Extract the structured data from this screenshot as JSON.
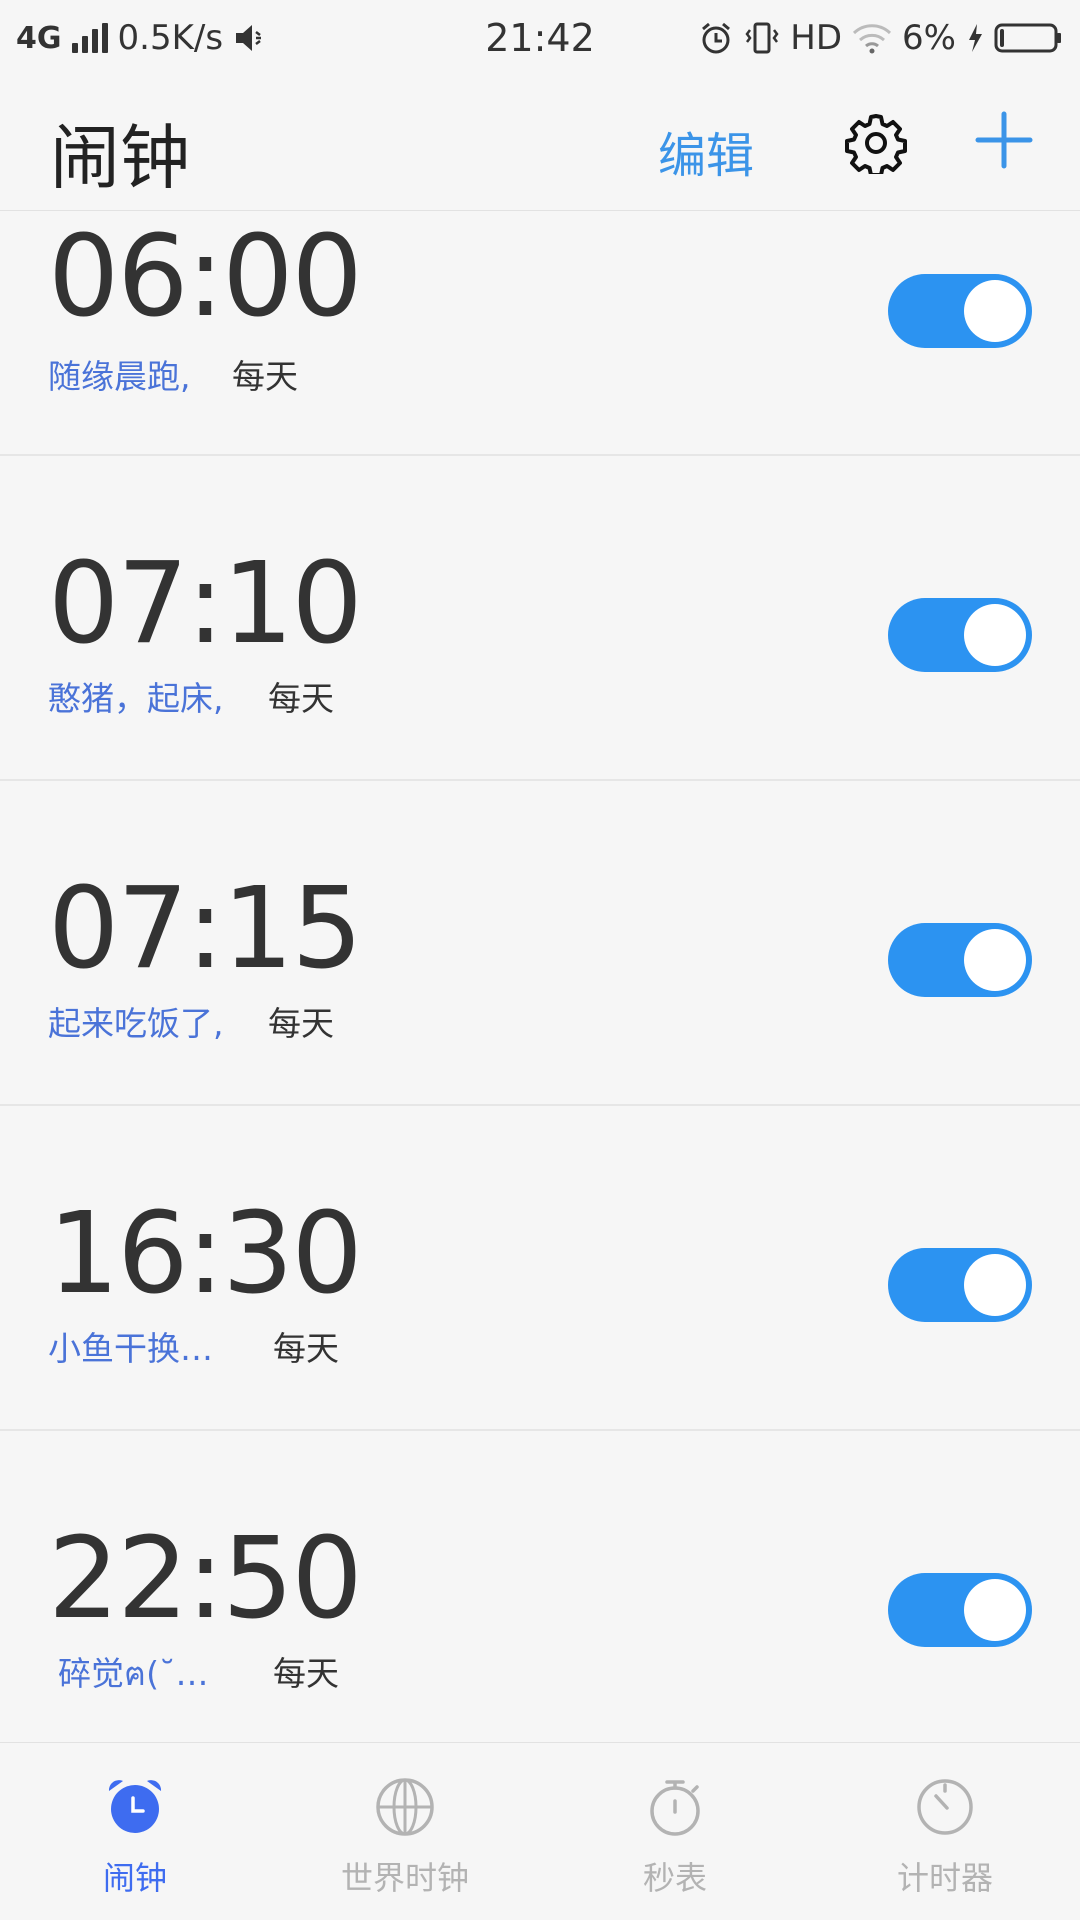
{
  "status_bar": {
    "network": "4G",
    "speed": "0.5K/s",
    "time": "21:42",
    "hd": "HD",
    "battery_percent": "6%",
    "battery_level": 0.06
  },
  "header": {
    "title": "闹钟",
    "edit_label": "编辑",
    "settings_icon": "gear-icon",
    "add_icon": "plus-icon"
  },
  "alarms": [
    {
      "time": "06:00",
      "label": "随缘晨跑,",
      "repeat": "每天",
      "enabled": true
    },
    {
      "time": "07:10",
      "label": "憨猪，起床,",
      "repeat": "每天",
      "enabled": true
    },
    {
      "time": "07:15",
      "label": "起来吃饭了,",
      "repeat": "每天",
      "enabled": true
    },
    {
      "time": "16:30",
      "label": "小鱼干换…",
      "repeat": "每天",
      "enabled": true
    },
    {
      "time": "22:50",
      "label": "碎觉ฅ(˘…",
      "repeat": "每天",
      "enabled": true
    }
  ],
  "bottom_nav": [
    {
      "label": "闹钟",
      "icon": "alarm-clock-icon",
      "active": true
    },
    {
      "label": "世界时钟",
      "icon": "globe-icon",
      "active": false
    },
    {
      "label": "秒表",
      "icon": "stopwatch-icon",
      "active": false
    },
    {
      "label": "计时器",
      "icon": "timer-icon",
      "active": false
    }
  ],
  "colors": {
    "accent": "#2c93f1",
    "label_blue": "#4a73d8",
    "nav_active": "#3e6cf0",
    "nav_inactive": "#b3b3b3",
    "background": "#f6f6f6"
  }
}
